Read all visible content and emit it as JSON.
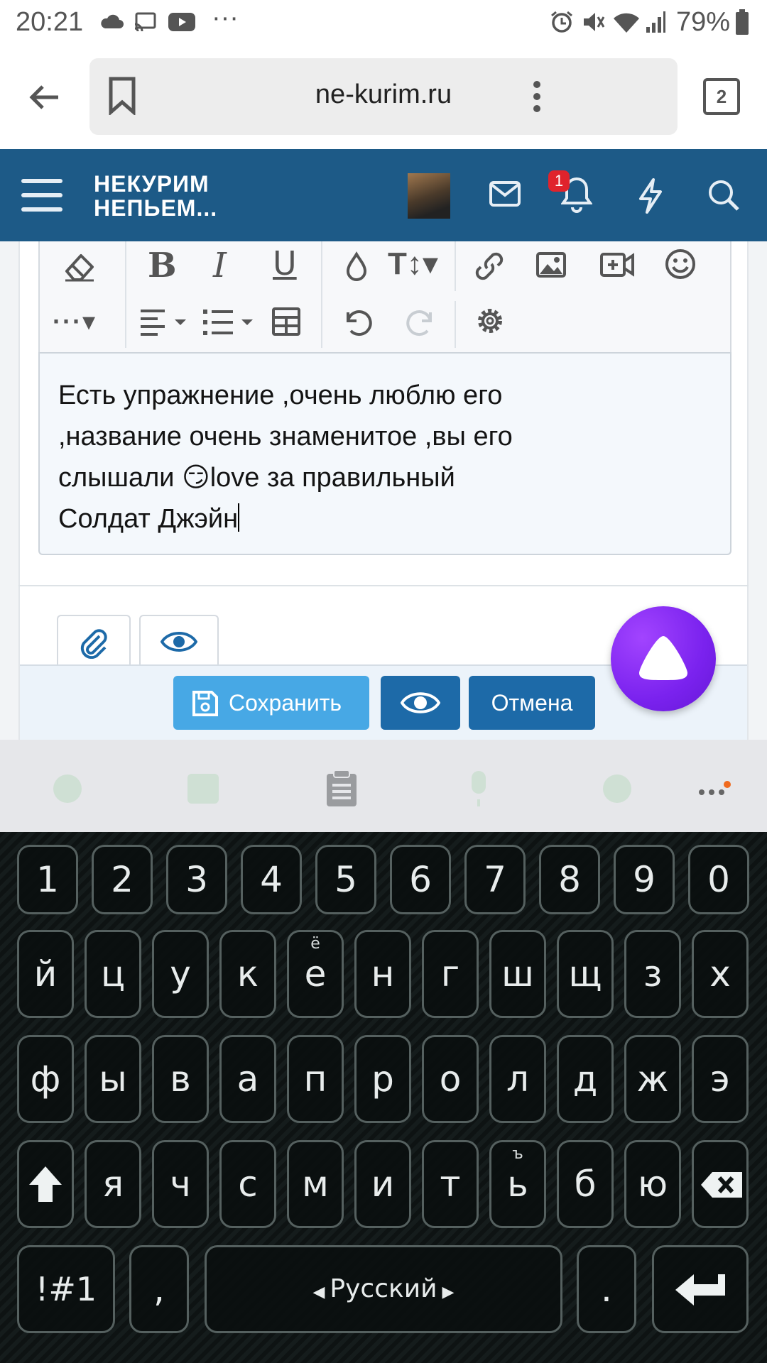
{
  "status_bar": {
    "time": "20:21",
    "battery": "79%",
    "more": "···",
    "icons": [
      "cloud-icon",
      "cast-icon",
      "youtube-icon",
      "alarm-icon",
      "mute-icon",
      "wifi-icon",
      "signal-icon",
      "battery-icon"
    ]
  },
  "browser": {
    "url": "ne-kurim.ru",
    "tabs_count": "2"
  },
  "site": {
    "logo_line1": "НЕКУРИМ",
    "logo_line2": "НЕПЬЕМ...",
    "notifications_count": "1",
    "brand_color": "#1d5a87"
  },
  "editor": {
    "text_line1": "Есть упражнение ,очень люблю его",
    "text_line2": ",название очень знаменитое ,вы его",
    "text_line3_before": "слышали ",
    "text_line3_emoji": "😏",
    "text_line3_after": "love за правильный",
    "text_line4": "Солдат Джэйн"
  },
  "form": {
    "save_label": "Сохранить",
    "cancel_label": "Отмена"
  },
  "keyboard": {
    "row_numbers": [
      "1",
      "2",
      "3",
      "4",
      "5",
      "6",
      "7",
      "8",
      "9",
      "0"
    ],
    "row1": [
      "й",
      "ц",
      "у",
      "к",
      "е",
      "н",
      "г",
      "ш",
      "щ",
      "з",
      "х"
    ],
    "row1_alt_e": "ё",
    "row2": [
      "ф",
      "ы",
      "в",
      "а",
      "п",
      "р",
      "о",
      "л",
      "д",
      "ж",
      "э"
    ],
    "row3": [
      "я",
      "ч",
      "с",
      "м",
      "и",
      "т",
      "ь",
      "б",
      "ю"
    ],
    "row3_alt_soft": "ъ",
    "symbols_label": "!#1",
    "comma": ",",
    "language_label": "Русский",
    "period": "."
  },
  "colors": {
    "save_button": "#47a8e5",
    "action_button": "#1d6aa8",
    "badge": "#e0232c",
    "alice": "#7a22ee"
  }
}
